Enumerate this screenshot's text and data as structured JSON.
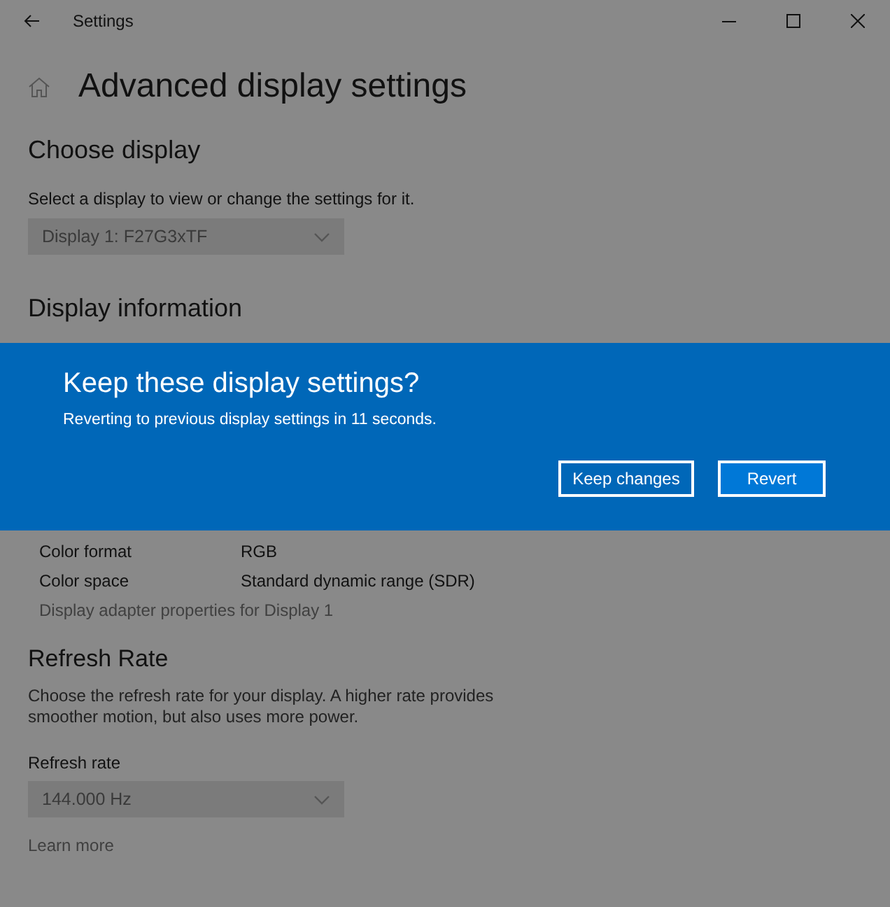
{
  "window": {
    "title": "Settings"
  },
  "page": {
    "title": "Advanced display settings"
  },
  "choose_display": {
    "heading": "Choose display",
    "description": "Select a display to view or change the settings for it.",
    "dropdown": {
      "value": "Display 1: F27G3xTF"
    }
  },
  "display_information": {
    "heading": "Display information"
  },
  "dialog": {
    "title": "Keep these display settings?",
    "message": "Reverting to previous display settings in 11 seconds.",
    "buttons": [
      {
        "label": "Keep changes",
        "kind": "outline"
      },
      {
        "label": "Revert",
        "kind": "primary"
      }
    ]
  },
  "info_rows": [
    {
      "label": "Color format",
      "value": "RGB"
    },
    {
      "label": "Color space",
      "value": "Standard dynamic range (SDR)"
    }
  ],
  "adapter_link": "Display adapter properties for Display 1",
  "refresh_rate": {
    "heading": "Refresh Rate",
    "description": "Choose the refresh rate for your display. A higher rate provides smoother motion, but also uses more power.",
    "label": "Refresh rate",
    "dropdown": {
      "value": "144.000 Hz"
    },
    "link": "Learn more"
  }
}
